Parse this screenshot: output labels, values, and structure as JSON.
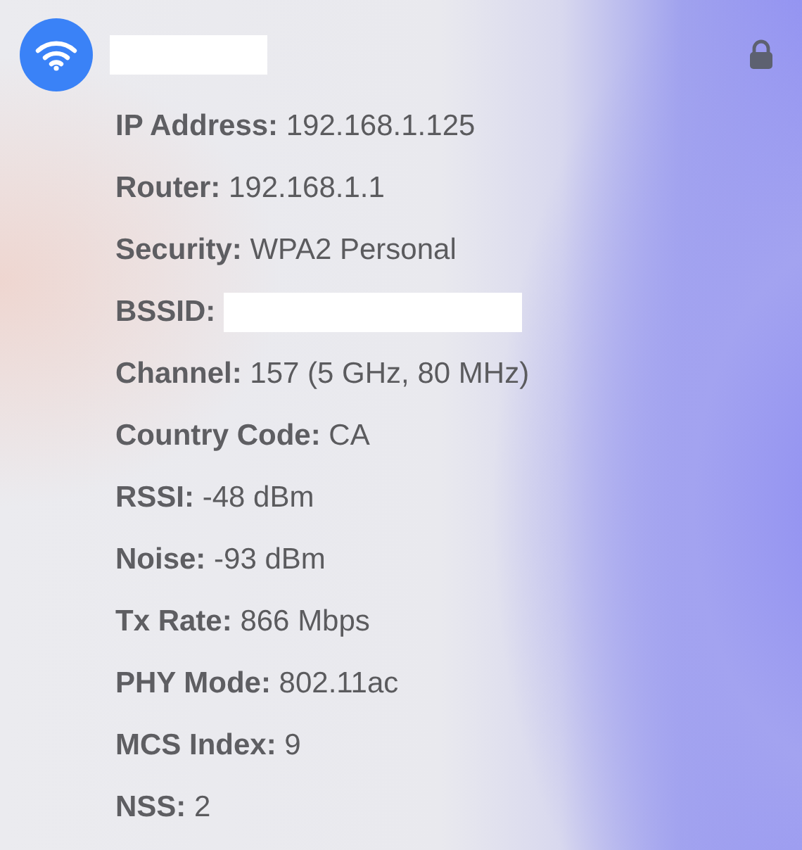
{
  "network": {
    "name_redacted": true,
    "locked": true
  },
  "details": [
    {
      "text": "**IP Address:** 192.168.1.125"
    },
    {
      "text": "**Router:** 192.168.1.1"
    },
    {
      "text": "**Security:** WPA2 Personal"
    },
    {
      "text": "**BSSID:**",
      "redacted": true
    },
    {
      "text": "**Channel:** 157 (5 GHz, 80 MHz)"
    },
    {
      "text": "**Country Code:** CA"
    },
    {
      "text": "**RSSI:** -48 dBm"
    },
    {
      "text": "**Noise:** -93 dBm"
    },
    {
      "text": "**Tx Rate:** 866 Mbps"
    },
    {
      "text": "**PHY Mode:** 802.11ac"
    },
    {
      "text": "**MCS Index:** 9"
    },
    {
      "text": "**NSS:** 2"
    }
  ]
}
